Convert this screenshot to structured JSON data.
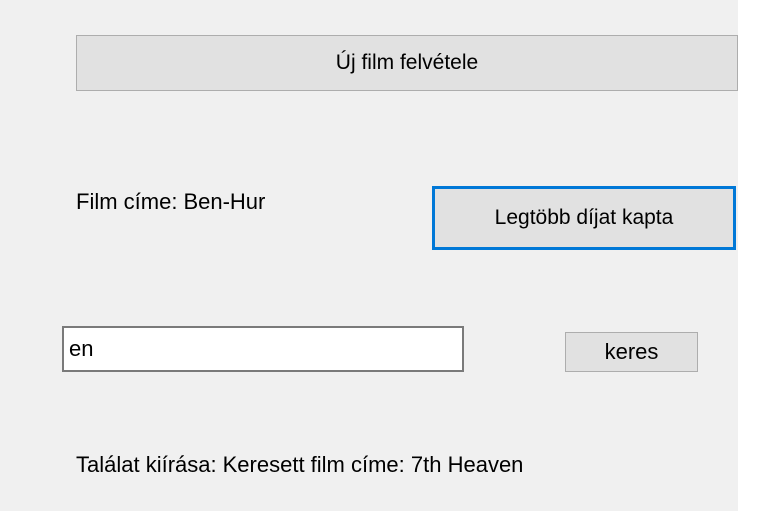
{
  "form": {
    "new_film_button": "Új film felvétele",
    "film_title_label": "Film címe:",
    "film_title_value": "Ben-Hur",
    "most_awards_button": "Legtöbb díjat kapta",
    "search_input_value": "en",
    "search_input_placeholder": "",
    "search_button": "keres",
    "result_label": "Találat kiírása:",
    "result_text": "Keresett film címe: 7th Heaven"
  },
  "colors": {
    "panel_background": "#f0f0f0",
    "button_background": "#e1e1e1",
    "button_border": "#adadad",
    "focus_border": "#0078d7"
  }
}
